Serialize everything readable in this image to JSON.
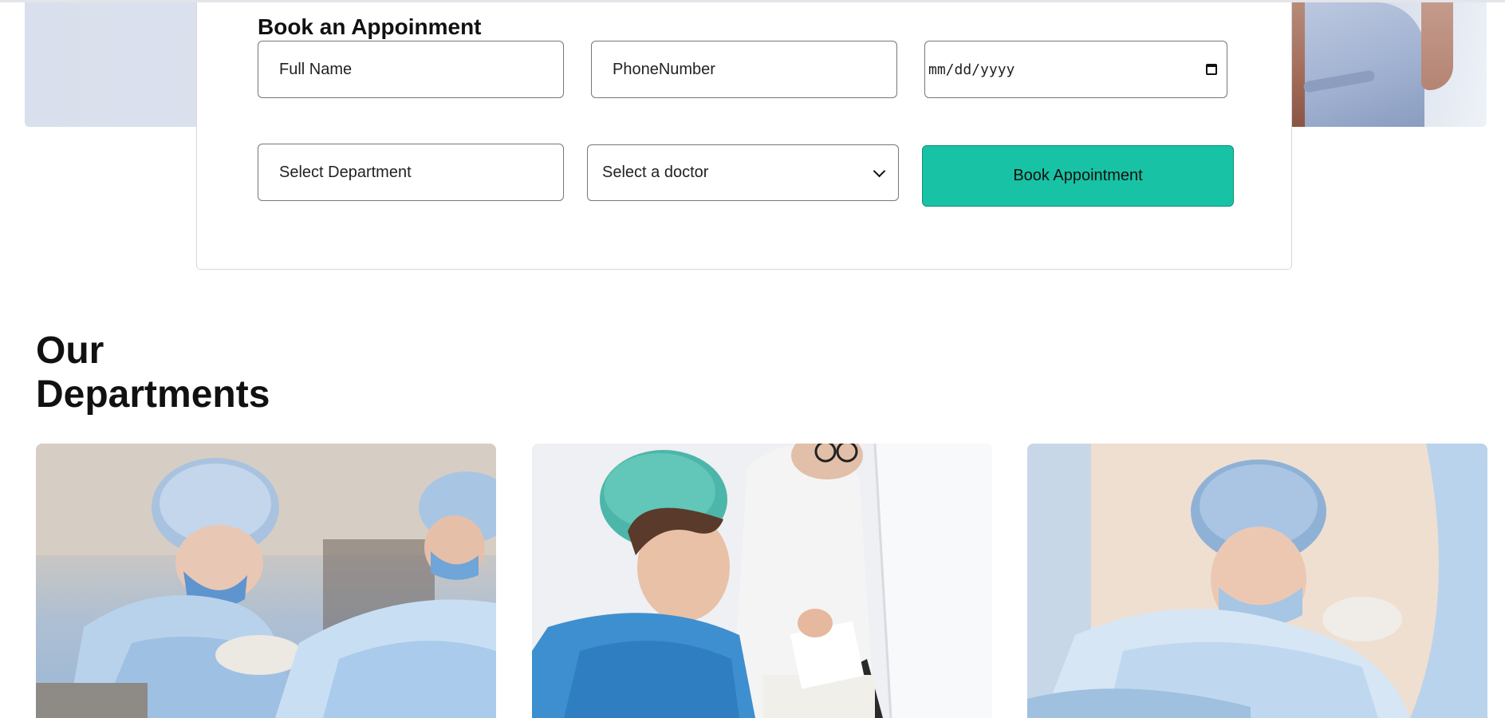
{
  "booking": {
    "title": "Book an Appoinment",
    "full_name_placeholder": "Full Name",
    "phone_placeholder": "PhoneNumber",
    "date_placeholder": "mm/dd/yyyy",
    "department_placeholder": "Select Department",
    "doctor_select_value": "Select a doctor",
    "submit_label": "Book Appointment"
  },
  "departments": {
    "heading_line1": "Our",
    "heading_line2": "Departments",
    "cards": [
      {
        "image": "surgeons-operating-photo"
      },
      {
        "image": "nurse-with-tablet-photo"
      },
      {
        "image": "surgeon-in-mask-photo"
      }
    ]
  },
  "colors": {
    "accent": "#18c3a5",
    "hero_bg": "#dfe4f0",
    "text": "#111111"
  },
  "icons": {
    "calendar": "calendar-icon",
    "select_caret": "chevron-down-icon"
  }
}
